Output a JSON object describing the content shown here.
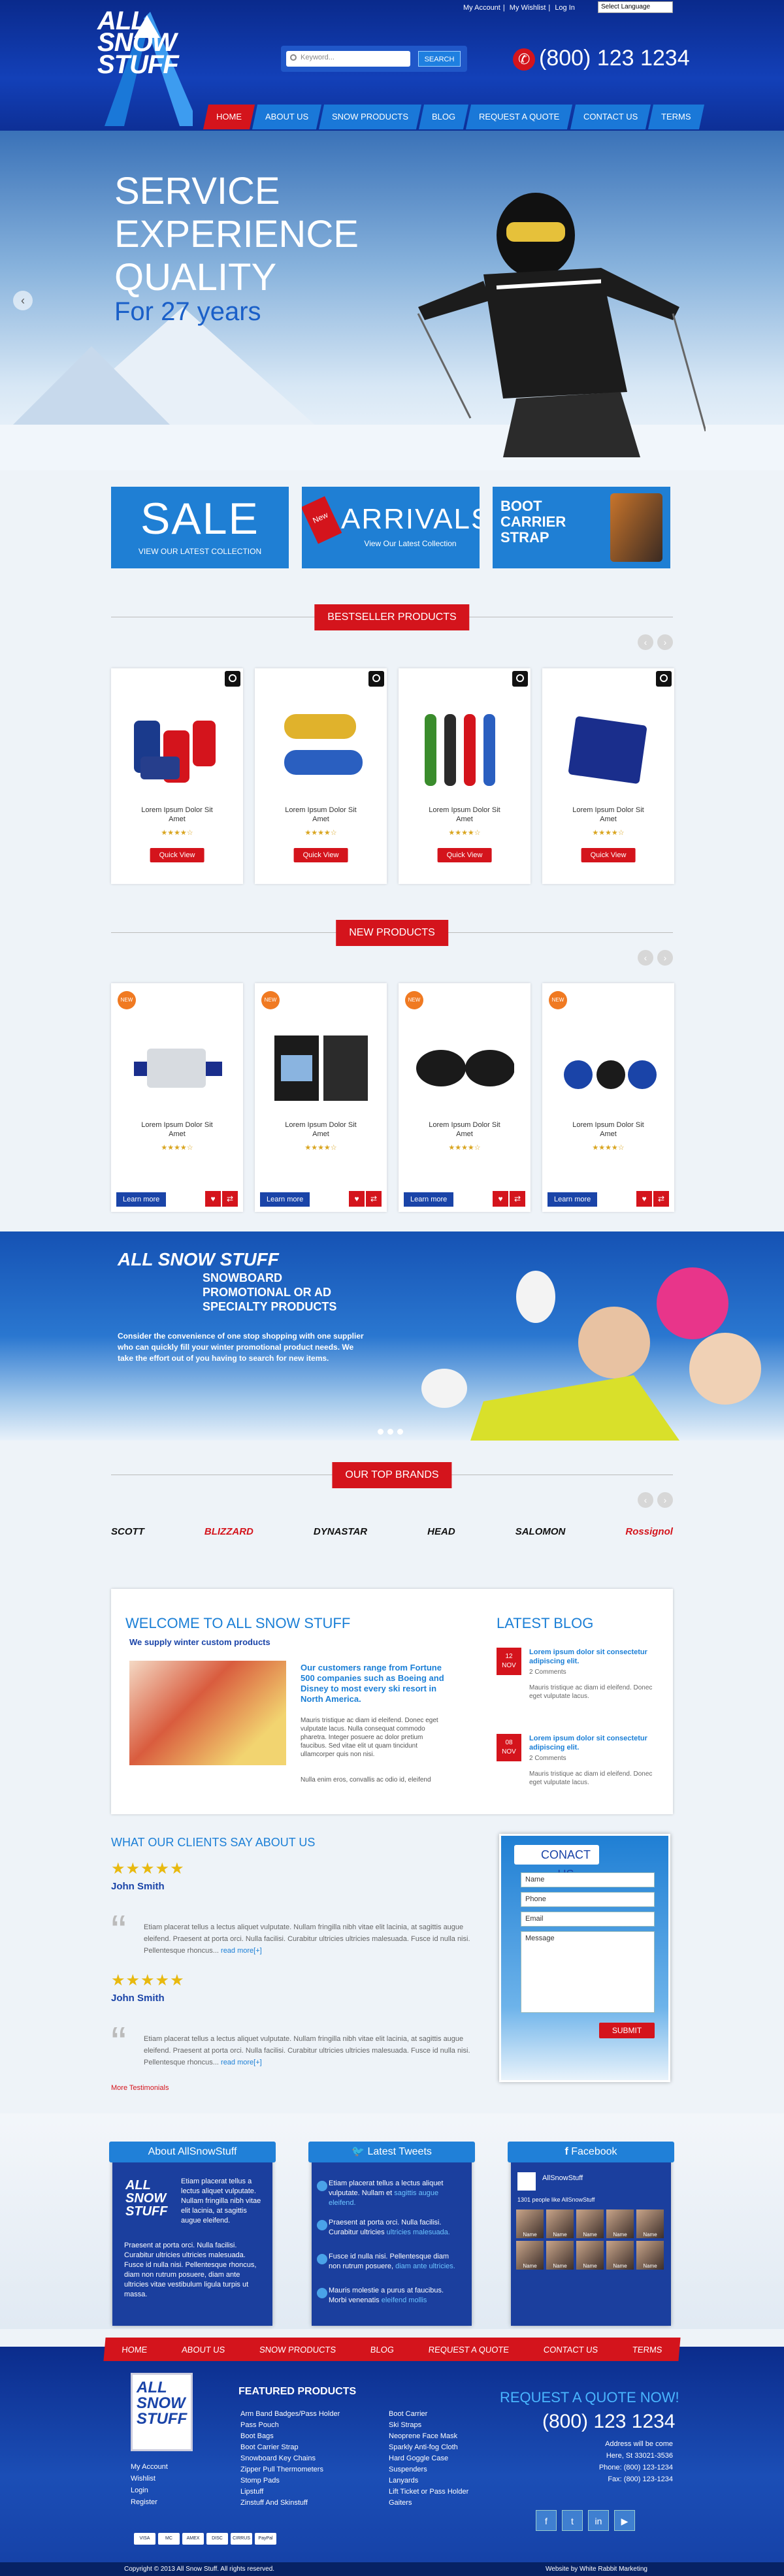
{
  "header": {
    "logo_text": "ALL SNOW STUFF",
    "top_links": [
      "My Account",
      "My Wishlist",
      "Log In"
    ],
    "language": "Select Language",
    "search_placeholder": "Keyword...",
    "search_button": "SEARCH",
    "phone": "(800) 123 1234",
    "nav": [
      "HOME",
      "ABOUT US",
      "SNOW PRODUCTS",
      "BLOG",
      "REQUEST A QUOTE",
      "CONTACT US",
      "TERMS"
    ]
  },
  "hero": {
    "line1": "SERVICE",
    "line2": "EXPERIENCE",
    "line3": "QUALITY",
    "line4": "For 27 years"
  },
  "promo": {
    "sale": "SALE",
    "sale_sub": "VIEW OUR LATEST COLLECTION",
    "arrivals": "ARRIVALS",
    "arrivals_tag": "New",
    "arrivals_sub": "View Our Latest Collection",
    "boot": "BOOT CARRIER STRAP"
  },
  "bestseller": {
    "heading": "BESTSELLER PRODUCTS",
    "items": [
      {
        "name": "Lorem Ipsum Dolor Sit Amet",
        "stars": "★★★★☆",
        "button": "Quick View"
      },
      {
        "name": "Lorem Ipsum Dolor Sit Amet",
        "stars": "★★★★☆",
        "button": "Quick View"
      },
      {
        "name": "Lorem Ipsum Dolor Sit Amet",
        "stars": "★★★★☆",
        "button": "Quick View"
      },
      {
        "name": "Lorem Ipsum Dolor Sit Amet",
        "stars": "★★★★☆",
        "button": "Quick View"
      }
    ]
  },
  "newproducts": {
    "heading": "NEW PRODUCTS",
    "badge": "NEW",
    "items": [
      {
        "name": "Lorem Ipsum Dolor Sit Amet",
        "stars": "★★★★☆",
        "button": "Learn more"
      },
      {
        "name": "Lorem Ipsum Dolor Sit Amet",
        "stars": "★★★★☆",
        "button": "Learn more"
      },
      {
        "name": "Lorem Ipsum Dolor Sit Amet",
        "stars": "★★★★☆",
        "button": "Learn more"
      },
      {
        "name": "Lorem Ipsum Dolor Sit Amet",
        "stars": "★★★★☆",
        "button": "Learn more"
      }
    ]
  },
  "snowboard": {
    "heading": "SNOWBOARD PROMOTIONAL OR AD SPECIALTY PRODUCTS",
    "text": "Consider the convenience of one stop shopping with one supplier who can quickly fill your winter promotional product needs. We take the effort out of you having to search for new items."
  },
  "brands": {
    "heading": "OUR TOP BRANDS",
    "list": [
      "SCOTT",
      "BLIZZARD",
      "DYNASTAR",
      "HEAD",
      "SALOMON",
      "Rossignol"
    ]
  },
  "welcome": {
    "heading": "WELCOME TO ALL SNOW STUFF",
    "sub": "We supply winter custom products",
    "highlight": "Our customers range from Fortune 500 companies such as Boeing and Disney to most every ski resort in North America.",
    "body": "Mauris tristique ac diam id eleifend. Donec eget vulputate lacus. Nulla consequat commodo pharetra. Integer posuere ac dolor pretium faucibus. Sed vitae elit ut quam tincidunt ullamcorper quis non nisi.",
    "body2": "Nulla enim eros, convallis ac odio id, eleifend"
  },
  "blog": {
    "heading": "LATEST BLOG",
    "posts": [
      {
        "day": "12",
        "month": "NOV",
        "title": "Lorem ipsum dolor sit consectetur adipiscing elit.",
        "comments": "2 Comments",
        "excerpt": "Mauris tristique ac diam id eleifend. Donec eget vulputate lacus."
      },
      {
        "day": "08",
        "month": "NOV",
        "title": "Lorem ipsum dolor sit consectetur adipiscing elit.",
        "comments": "2 Comments",
        "excerpt": "Mauris tristique ac diam id eleifend. Donec eget vulputate lacus."
      }
    ]
  },
  "testimonials": {
    "heading": "WHAT OUR CLIENTS SAY ABOUT US",
    "items": [
      {
        "stars": "★★★★★",
        "name": "John Smith",
        "text": "Etiam placerat tellus a lectus aliquet vulputate. Nullam fringilla nibh vitae elit lacinia, at sagittis augue eleifend. Praesent at porta orci. Nulla facilisi. Curabitur ultricies ultricies malesuada. Fusce id nulla nisi. Pellentesque rhoncus...",
        "more": "read more[+]"
      },
      {
        "stars": "★★★★★",
        "name": "John Smith",
        "text": "Etiam placerat tellus a lectus aliquet vulputate. Nullam fringilla nibh vitae elit lacinia, at sagittis augue eleifend. Praesent at porta orci. Nulla facilisi. Curabitur ultricies ultricies malesuada. Fusce id nulla nisi. Pellentesque rhoncus...",
        "more": "read more[+]"
      }
    ],
    "more_link": "More Testimonials"
  },
  "contact": {
    "heading": "CONACT US",
    "name": "Name",
    "phone": "Phone",
    "email": "Email",
    "message": "Message",
    "submit": "SUBMIT"
  },
  "widgets": {
    "about": {
      "heading": "About AllSnowStuff",
      "text1": "Etiam placerat tellus a lectus aliquet vulputate. Nullam fringilla nibh vitae elit lacinia, at sagittis augue eleifend.",
      "text2": "Praesent at porta orci. Nulla facilisi. Curabitur ultricies ultricies malesuada. Fusce id nulla nisi. Pellentesque rhoncus, diam non rutrum posuere, diam ante ultricies vitae vestibulum ligula turpis ut massa."
    },
    "tweets": {
      "heading": "Latest Tweets",
      "items": [
        {
          "text": "Etiam placerat tellus a lectus aliquet vulputate. Nullam et ",
          "link": "sagittis augue eleifend."
        },
        {
          "text": "Praesent at porta orci. Nulla facilisi. Curabitur ultricies ",
          "link": "ultricies malesuada."
        },
        {
          "text": "Fusce id nulla nisi. Pellentesque diam non rutrum posuere, ",
          "link": "diam ante ultricies."
        },
        {
          "text": "Mauris molestie a purus at faucibus. Morbi venenatis ",
          "link": "eleifend mollis"
        }
      ]
    },
    "facebook": {
      "heading": "Facebook",
      "page": "AllSnowStuff",
      "likes": "1301 people like AllSnowStuff",
      "people": [
        "Name",
        "Name",
        "Name",
        "Name",
        "Name",
        "Name",
        "Name",
        "Name",
        "Name",
        "Name"
      ]
    }
  },
  "footer": {
    "nav": [
      "HOME",
      "ABOUT US",
      "SNOW PRODUCTS",
      "BLOG",
      "REQUEST A QUOTE",
      "CONTACT US",
      "TERMS"
    ],
    "account_links": [
      "My Account",
      "Wishlist",
      "Login",
      "Register"
    ],
    "featured_heading": "FEATURED PRODUCTS",
    "col1": [
      "Arm Band Badges/Pass Holder",
      "Pass Pouch",
      "Boot Bags",
      "Boot Carrier Strap",
      "Snowboard Key Chains",
      "Zipper Pull Thermometers",
      "Stomp Pads",
      "Lipstuff",
      "Zinstuff And Skinstuff"
    ],
    "col2": [
      "Boot Carrier",
      "Ski Straps",
      "Neoprene Face Mask",
      "Sparkly Anti-fog Cloth",
      "Hard Goggle Case",
      "Suspenders",
      "Lanyards",
      "Lift Ticket or Pass Holder",
      "Gaiters"
    ],
    "quote": "REQUEST A QUOTE NOW!",
    "phone": "(800) 123 1234",
    "address": [
      "Address will be come",
      "Here, St 33021-3536",
      "Phone: (800) 123-1234",
      "Fax: (800) 123-1234"
    ],
    "payments": [
      "VISA",
      "MC",
      "AMEX",
      "DISC",
      "CIRRUS",
      "PayPal"
    ],
    "copyright": "Copyright © 2013 All Snow Stuff. All rights reserved.",
    "credit": "Website by White Rabbit Marketing"
  }
}
